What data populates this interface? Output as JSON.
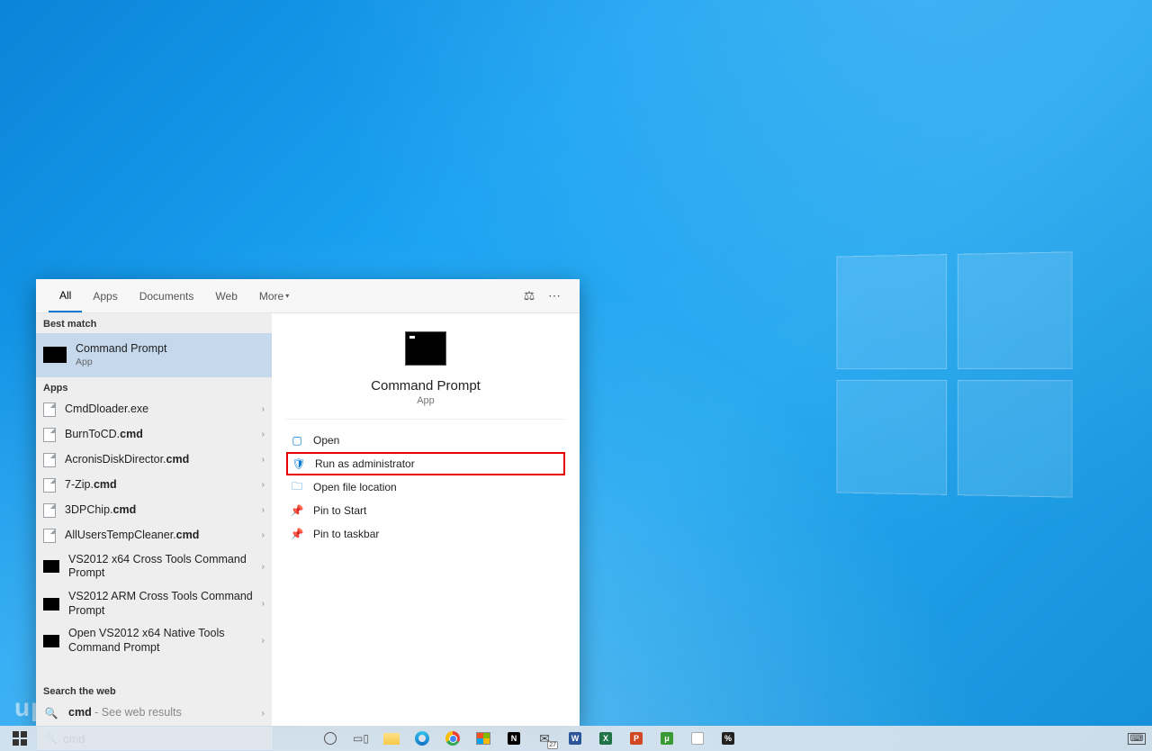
{
  "tabs": {
    "all": "All",
    "apps": "Apps",
    "documents": "Documents",
    "web": "Web",
    "more": "More"
  },
  "sections": {
    "best": "Best match",
    "apps": "Apps",
    "web": "Search the web"
  },
  "best": {
    "title": "Command Prompt",
    "sub": "App"
  },
  "apps": [
    {
      "name_pre": "Cmd",
      "name_bold": "",
      "name_post": "Dloader.exe",
      "kind": "file"
    },
    {
      "name_pre": "BurnToCD.",
      "name_bold": "cmd",
      "name_post": "",
      "kind": "file"
    },
    {
      "name_pre": "AcronisDiskDirector.",
      "name_bold": "cmd",
      "name_post": "",
      "kind": "file"
    },
    {
      "name_pre": "7-Zip.",
      "name_bold": "cmd",
      "name_post": "",
      "kind": "file"
    },
    {
      "name_pre": "3DPChip.",
      "name_bold": "cmd",
      "name_post": "",
      "kind": "file"
    },
    {
      "name_pre": "AllUsersTempCleaner.",
      "name_bold": "cmd",
      "name_post": "",
      "kind": "file"
    },
    {
      "name_pre": "VS2012 x64 Cross Tools Command Prompt",
      "name_bold": "",
      "name_post": "",
      "kind": "terminal"
    },
    {
      "name_pre": "VS2012 ARM Cross Tools Command Prompt",
      "name_bold": "",
      "name_post": "",
      "kind": "terminal"
    },
    {
      "name_pre": "Open VS2012 x64 Native Tools Command Prompt",
      "name_bold": "",
      "name_post": "",
      "kind": "terminal"
    }
  ],
  "web": {
    "query": "cmd",
    "hint": " - See web results"
  },
  "preview": {
    "title": "Command Prompt",
    "sub": "App"
  },
  "actions": [
    {
      "label": "Open",
      "icon": "open"
    },
    {
      "label": "Run as administrator",
      "icon": "shield",
      "highlight": true
    },
    {
      "label": "Open file location",
      "icon": "folder"
    },
    {
      "label": "Pin to Start",
      "icon": "pin"
    },
    {
      "label": "Pin to taskbar",
      "icon": "pin"
    }
  ],
  "search": {
    "value": "cmd"
  },
  "taskbar": {
    "mail_badge": "27"
  },
  "watermark": "uplotify"
}
